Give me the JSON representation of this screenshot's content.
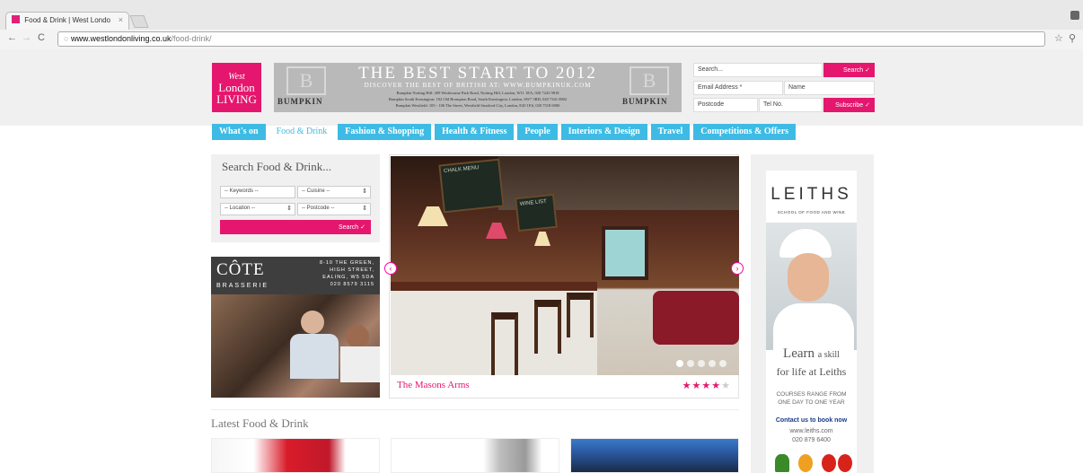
{
  "browser": {
    "tab_title": "Food & Drink | West Londo",
    "tab_close": "×",
    "url_host": "www.westlondonliving.co.uk",
    "url_path": "/food-drink/"
  },
  "header": {
    "logo_line1": "West",
    "logo_line2": "London",
    "logo_line3": "LIVING",
    "banner": {
      "mark": "B",
      "title": "THE BEST START TO 2012",
      "subtitle": "DISCOVER THE BEST OF BRITISH AT: WWW.BUMPKINUK.COM",
      "line1": "Bumpkin Notting Hill: 209 Westbourne Park Road, Notting Hill, London, W11 1EA, 020 7243 9818",
      "line2": "Bumpkin South Kensington: 102 Old Brompton Road, South Kensington, London, SW7 3RD, 020 7341 0802",
      "line3": "Bumpkin Westfield: 105 - 106 The Street, Westfield Stratford City, London, E20 1ES, 020 7518 6900",
      "brand": "BUMPKIN"
    },
    "search_placeholder": "Search...",
    "search_button": "Search ✓",
    "email_placeholder": "Email Address *",
    "name_placeholder": "Name",
    "postcode_placeholder": "Postcode",
    "tel_placeholder": "Tel No.",
    "subscribe_button": "Subscribe ✓"
  },
  "menu": [
    {
      "label": "What's on"
    },
    {
      "label": "Food & Drink"
    },
    {
      "label": "Fashion & Shopping"
    },
    {
      "label": "Health & Fitness"
    },
    {
      "label": "People"
    },
    {
      "label": "Interiors & Design"
    },
    {
      "label": "Travel"
    },
    {
      "label": "Competitions & Offers"
    }
  ],
  "search_panel": {
    "title": "Search Food & Drink...",
    "keywords": "-- Keywords --",
    "cuisine": "-- Cuisine --",
    "location": "-- Location --",
    "postcode": "-- Postcode --",
    "button": "Search ✓"
  },
  "cote_ad": {
    "name": "CÔTE",
    "sub": "BRASSERIE",
    "addr1": "8-10 THE GREEN,",
    "addr2": "HIGH STREET,",
    "addr3": "EALING, W5 5DA",
    "phone": "020 8579 3115"
  },
  "slider": {
    "caption": "The Masons Arms",
    "rating": 4,
    "rating_max": 5,
    "prev": "‹",
    "next": "›",
    "board1": "CHALK MENU",
    "board2": "WINE LIST"
  },
  "leiths_ad": {
    "title": "LEITHS",
    "sub": "SCHOOL OF FOOD AND WINE",
    "learn": "Learn",
    "askill": "a skill",
    "life": "for life at Leiths",
    "courses_1": "COURSES RANGE FROM",
    "courses_2": "ONE DAY TO ONE YEAR",
    "contact": "Contact us to book now",
    "web": "www.leiths.com",
    "phone": "020 879 6400"
  },
  "latest": {
    "title": "Latest Food & Drink"
  }
}
